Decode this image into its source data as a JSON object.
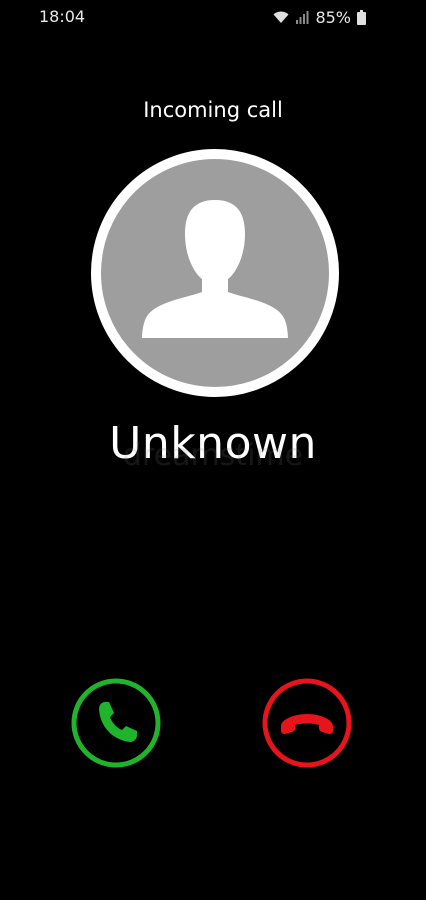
{
  "status_bar": {
    "time": "18:04",
    "battery_percent": "85%",
    "icons": [
      "wifi-icon",
      "signal-icon",
      "battery-icon"
    ]
  },
  "call": {
    "label": "Incoming call",
    "caller_name": "Unknown",
    "avatar_icon": "person-silhouette-icon"
  },
  "watermark": "dreamstime",
  "actions": {
    "accept": {
      "icon": "phone-accept-icon",
      "color": "#1fb42b"
    },
    "decline": {
      "icon": "phone-decline-icon",
      "color": "#e8141c"
    }
  },
  "colors": {
    "background": "#000000",
    "avatar_ring": "#ffffff",
    "avatar_fill": "#9e9e9e"
  }
}
